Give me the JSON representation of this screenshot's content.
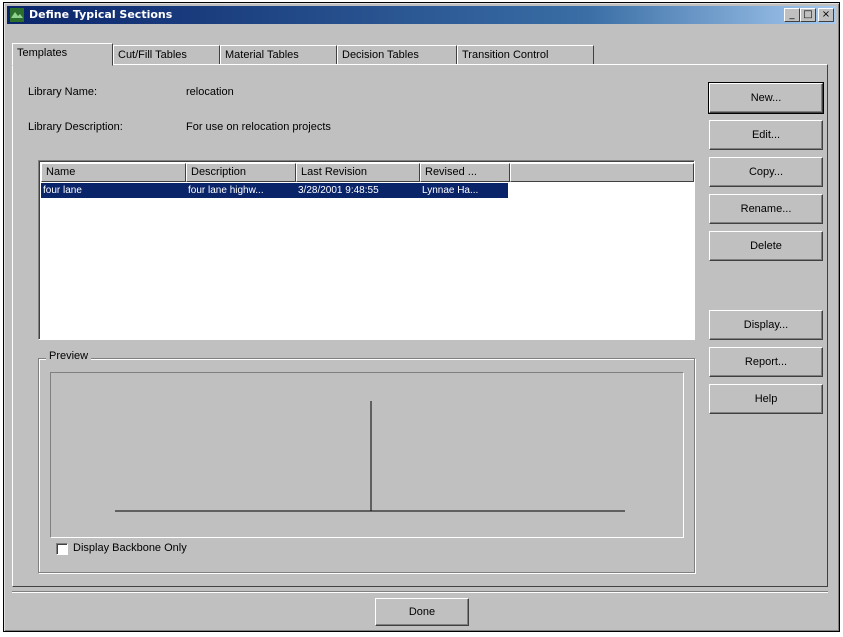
{
  "window": {
    "title": "Define Typical Sections",
    "title_icon": "app-icon",
    "minimize_glyph": "_",
    "maximize_glyph": "□",
    "close_glyph": "×"
  },
  "tabs": [
    {
      "label": "Templates",
      "active": true
    },
    {
      "label": "Cut/Fill Tables",
      "active": false
    },
    {
      "label": "Material Tables",
      "active": false
    },
    {
      "label": "Decision Tables",
      "active": false
    },
    {
      "label": "Transition Control",
      "active": false
    }
  ],
  "library": {
    "name_label": "Library Name:",
    "name_value": "relocation",
    "description_label": "Library Description:",
    "description_value": "For use on relocation projects"
  },
  "list": {
    "columns": [
      "Name",
      "Description",
      "Last Revision",
      "Revised ..."
    ],
    "rows": [
      {
        "name": "four lane",
        "description": "four lane highw...",
        "last_revision": "3/28/2001 9:48:55",
        "revised_by": "Lynnae Ha...",
        "selected": true
      }
    ]
  },
  "buttons": {
    "new": "New...",
    "edit": "Edit...",
    "copy": "Copy...",
    "rename": "Rename...",
    "delete": "Delete",
    "display": "Display...",
    "report": "Report...",
    "help": "Help",
    "done": "Done"
  },
  "preview": {
    "group_label": "Preview",
    "backbone_checkbox_label": "Display Backbone Only",
    "backbone_checked": false
  },
  "colors": {
    "face": "#c0c0c0",
    "selection": "#0a246a",
    "title_bar_start": "#0a246a"
  }
}
